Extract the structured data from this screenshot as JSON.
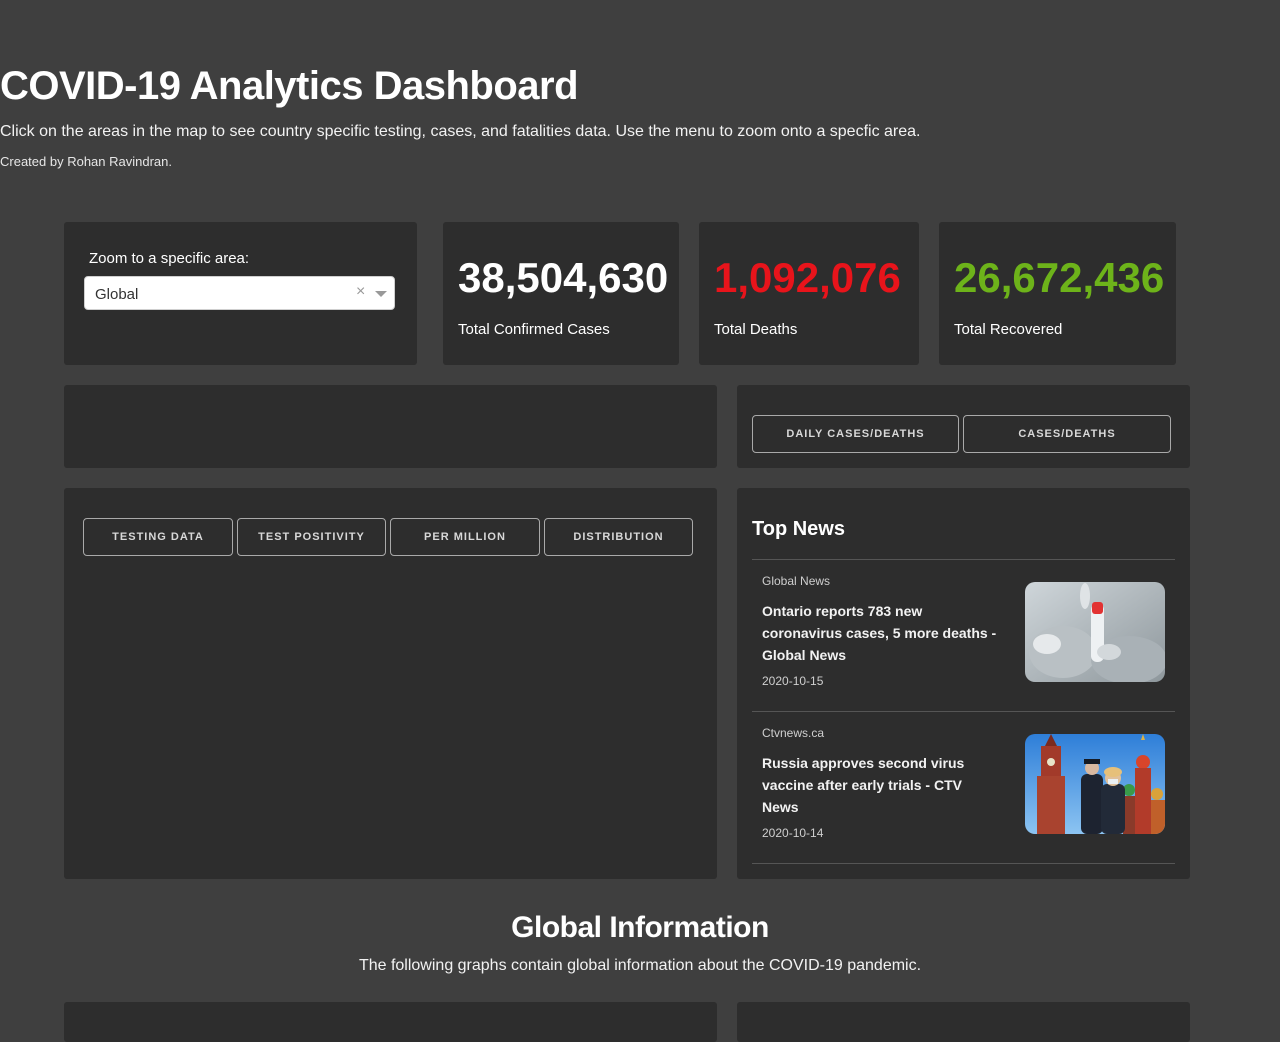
{
  "header": {
    "title": "COVID-19 Analytics Dashboard",
    "subtitle": "Click on the areas in the map to see country specific testing, cases, and fatalities data. Use the menu to zoom onto a specfic area.",
    "credit": "Created by Rohan Ravindran."
  },
  "zoom": {
    "label": "Zoom to a specific area:",
    "selected": "Global",
    "clear_symbol": "×"
  },
  "stats": {
    "confirmed": {
      "value": "38,504,630",
      "label": "Total Confirmed Cases",
      "color": "#ffffff"
    },
    "deaths": {
      "value": "1,092,076",
      "label": "Total Deaths",
      "color": "#e8141b"
    },
    "recovered": {
      "value": "26,672,436",
      "label": "Total Recovered",
      "color": "#6db31a"
    }
  },
  "cases_buttons": {
    "daily": "DAILY CASES/DEATHS",
    "cumulative": "CASES/DEATHS"
  },
  "testing_buttons": {
    "testing": "TESTING DATA",
    "positivity": "TEST POSITIVITY",
    "per_million": "PER MILLION",
    "distribution": "DISTRIBUTION"
  },
  "news": {
    "title": "Top News",
    "items": [
      {
        "source": "Global News",
        "headline": "Ontario reports 783 new coronavirus cases, 5 more deaths - Global News",
        "date": "2020-10-15",
        "image": "test-tube-photo"
      },
      {
        "source": "Ctvnews.ca",
        "headline": "Russia approves second virus vaccine after early trials - CTV News",
        "date": "2020-10-14",
        "image": "kremlin-photo"
      }
    ]
  },
  "global_info": {
    "title": "Global Information",
    "subtitle": "The following graphs contain global information about the COVID-19 pandemic."
  }
}
